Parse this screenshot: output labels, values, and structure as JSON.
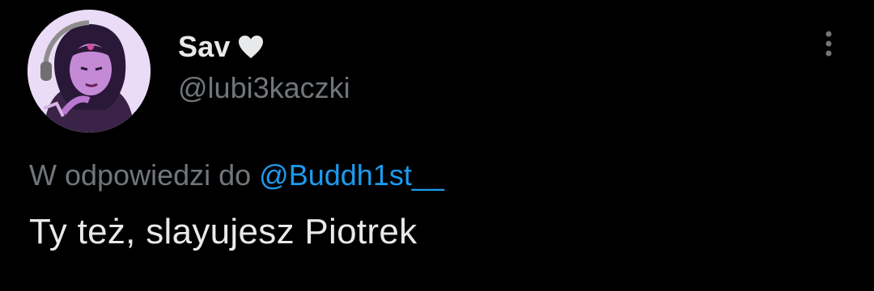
{
  "author": {
    "display_name": "Sav",
    "name_emoji": "heart-icon",
    "handle": "@lubi3kaczki",
    "avatar": "avatar-illustration"
  },
  "reply_context": {
    "prefix": "W odpowiedzi do",
    "mention": "@Buddh1st__"
  },
  "tweet": {
    "text": "Ty też, slayujesz Piotrek"
  },
  "menu": {
    "icon": "more-vertical-icon"
  },
  "colors": {
    "background": "#000000",
    "primary_text": "#e7e9ea",
    "secondary_text": "#71767b",
    "link": "#1d9bf0"
  }
}
